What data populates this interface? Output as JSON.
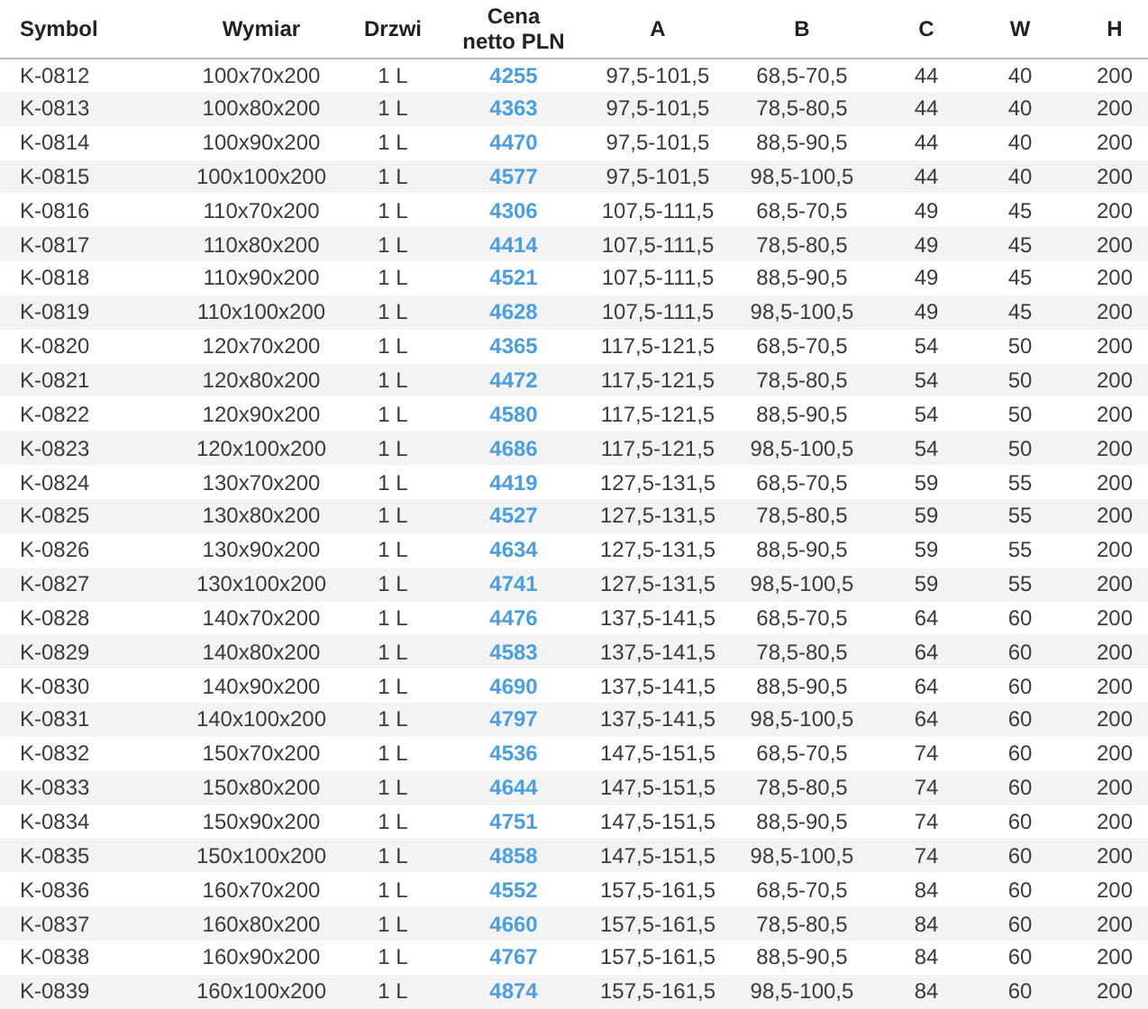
{
  "table": {
    "columns": [
      "Symbol",
      "Wymiar",
      "Drzwi",
      "Cena netto PLN",
      "A",
      "B",
      "C",
      "W",
      "H"
    ],
    "rows": [
      [
        "K-0812",
        "100x70x200",
        "1 L",
        "4255",
        "97,5-101,5",
        "68,5-70,5",
        "44",
        "40",
        "200"
      ],
      [
        "K-0813",
        "100x80x200",
        "1 L",
        "4363",
        "97,5-101,5",
        "78,5-80,5",
        "44",
        "40",
        "200"
      ],
      [
        "K-0814",
        "100x90x200",
        "1 L",
        "4470",
        "97,5-101,5",
        "88,5-90,5",
        "44",
        "40",
        "200"
      ],
      [
        "K-0815",
        "100x100x200",
        "1 L",
        "4577",
        "97,5-101,5",
        "98,5-100,5",
        "44",
        "40",
        "200"
      ],
      [
        "K-0816",
        "110x70x200",
        "1 L",
        "4306",
        "107,5-111,5",
        "68,5-70,5",
        "49",
        "45",
        "200"
      ],
      [
        "K-0817",
        "110x80x200",
        "1 L",
        "4414",
        "107,5-111,5",
        "78,5-80,5",
        "49",
        "45",
        "200"
      ],
      [
        "K-0818",
        "110x90x200",
        "1 L",
        "4521",
        "107,5-111,5",
        "88,5-90,5",
        "49",
        "45",
        "200"
      ],
      [
        "K-0819",
        "110x100x200",
        "1 L",
        "4628",
        "107,5-111,5",
        "98,5-100,5",
        "49",
        "45",
        "200"
      ],
      [
        "K-0820",
        "120x70x200",
        "1 L",
        "4365",
        "117,5-121,5",
        "68,5-70,5",
        "54",
        "50",
        "200"
      ],
      [
        "K-0821",
        "120x80x200",
        "1 L",
        "4472",
        "117,5-121,5",
        "78,5-80,5",
        "54",
        "50",
        "200"
      ],
      [
        "K-0822",
        "120x90x200",
        "1 L",
        "4580",
        "117,5-121,5",
        "88,5-90,5",
        "54",
        "50",
        "200"
      ],
      [
        "K-0823",
        "120x100x200",
        "1 L",
        "4686",
        "117,5-121,5",
        "98,5-100,5",
        "54",
        "50",
        "200"
      ],
      [
        "K-0824",
        "130x70x200",
        "1 L",
        "4419",
        "127,5-131,5",
        "68,5-70,5",
        "59",
        "55",
        "200"
      ],
      [
        "K-0825",
        "130x80x200",
        "1 L",
        "4527",
        "127,5-131,5",
        "78,5-80,5",
        "59",
        "55",
        "200"
      ],
      [
        "K-0826",
        "130x90x200",
        "1 L",
        "4634",
        "127,5-131,5",
        "88,5-90,5",
        "59",
        "55",
        "200"
      ],
      [
        "K-0827",
        "130x100x200",
        "1 L",
        "4741",
        "127,5-131,5",
        "98,5-100,5",
        "59",
        "55",
        "200"
      ],
      [
        "K-0828",
        "140x70x200",
        "1 L",
        "4476",
        "137,5-141,5",
        "68,5-70,5",
        "64",
        "60",
        "200"
      ],
      [
        "K-0829",
        "140x80x200",
        "1 L",
        "4583",
        "137,5-141,5",
        "78,5-80,5",
        "64",
        "60",
        "200"
      ],
      [
        "K-0830",
        "140x90x200",
        "1 L",
        "4690",
        "137,5-141,5",
        "88,5-90,5",
        "64",
        "60",
        "200"
      ],
      [
        "K-0831",
        "140x100x200",
        "1 L",
        "4797",
        "137,5-141,5",
        "98,5-100,5",
        "64",
        "60",
        "200"
      ],
      [
        "K-0832",
        "150x70x200",
        "1 L",
        "4536",
        "147,5-151,5",
        "68,5-70,5",
        "74",
        "60",
        "200"
      ],
      [
        "K-0833",
        "150x80x200",
        "1 L",
        "4644",
        "147,5-151,5",
        "78,5-80,5",
        "74",
        "60",
        "200"
      ],
      [
        "K-0834",
        "150x90x200",
        "1 L",
        "4751",
        "147,5-151,5",
        "88,5-90,5",
        "74",
        "60",
        "200"
      ],
      [
        "K-0835",
        "150x100x200",
        "1 L",
        "4858",
        "147,5-151,5",
        "98,5-100,5",
        "74",
        "60",
        "200"
      ],
      [
        "K-0836",
        "160x70x200",
        "1 L",
        "4552",
        "157,5-161,5",
        "68,5-70,5",
        "84",
        "60",
        "200"
      ],
      [
        "K-0837",
        "160x80x200",
        "1 L",
        "4660",
        "157,5-161,5",
        "78,5-80,5",
        "84",
        "60",
        "200"
      ],
      [
        "K-0838",
        "160x90x200",
        "1 L",
        "4767",
        "157,5-161,5",
        "88,5-90,5",
        "84",
        "60",
        "200"
      ],
      [
        "K-0839",
        "160x100x200",
        "1 L",
        "4874",
        "157,5-161,5",
        "98,5-100,5",
        "84",
        "60",
        "200"
      ]
    ]
  }
}
